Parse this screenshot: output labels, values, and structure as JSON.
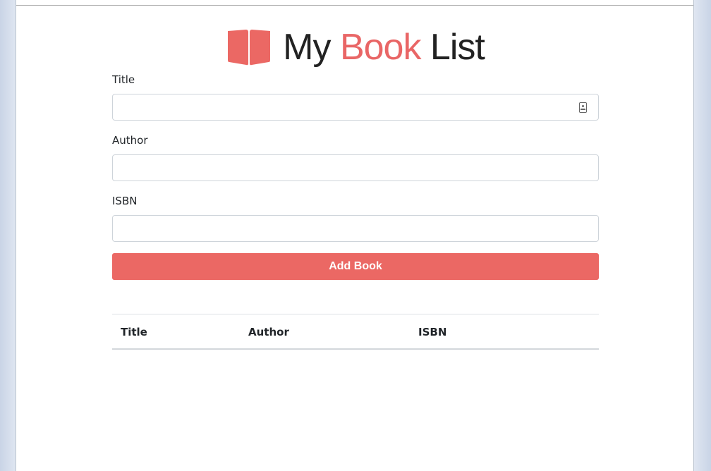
{
  "brand": {
    "word1": "My",
    "word2": "Book",
    "word3": "List",
    "icon": "book-open-icon",
    "accent_color": "#eb6864"
  },
  "form": {
    "title_label": "Title",
    "title_value": "",
    "author_label": "Author",
    "author_value": "",
    "isbn_label": "ISBN",
    "isbn_value": "",
    "submit_label": "Add Book"
  },
  "table": {
    "headers": [
      "Title",
      "Author",
      "ISBN"
    ],
    "rows": []
  }
}
